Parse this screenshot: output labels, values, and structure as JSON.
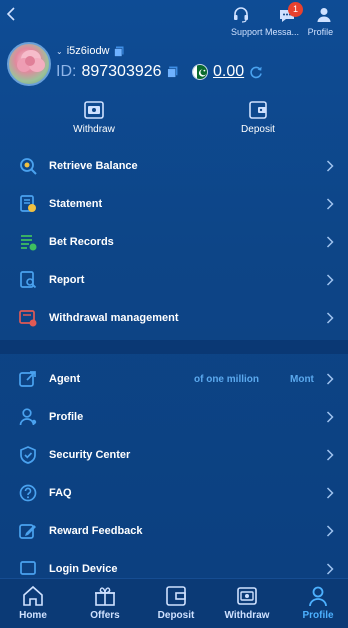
{
  "topbar": {
    "support_label": "Support",
    "message_label": "Messa...",
    "message_badge": "1",
    "profile_label": "Profile"
  },
  "user": {
    "username": "i5z6iodw",
    "id_prefix": "ID:",
    "id_value": "897303926",
    "balance": "0.00"
  },
  "actions": {
    "withdraw_label": "Withdraw",
    "deposit_label": "Deposit"
  },
  "menu": {
    "items": [
      {
        "label": "Retrieve Balance",
        "icon": "search-balance-icon"
      },
      {
        "label": "Statement",
        "icon": "statement-icon"
      },
      {
        "label": "Bet Records",
        "icon": "bet-records-icon"
      },
      {
        "label": "Report",
        "icon": "report-icon"
      },
      {
        "label": "Withdrawal management",
        "icon": "withdrawal-management-icon"
      },
      {
        "label": "Agent",
        "icon": "agent-icon",
        "extra1": "of one million",
        "extra2": "Mont"
      },
      {
        "label": "Profile",
        "icon": "profile-icon"
      },
      {
        "label": "Security Center",
        "icon": "security-icon"
      },
      {
        "label": "FAQ",
        "icon": "faq-icon"
      },
      {
        "label": "Reward Feedback",
        "icon": "reward-feedback-icon"
      },
      {
        "label": "Login Device",
        "icon": "login-device-icon"
      }
    ]
  },
  "nav": {
    "home": "Home",
    "offers": "Offers",
    "deposit": "Deposit",
    "withdraw": "Withdraw",
    "profile": "Profile"
  },
  "colors": {
    "background": "#0d4587",
    "accent": "#4db1ff",
    "badge": "#e8412e"
  }
}
